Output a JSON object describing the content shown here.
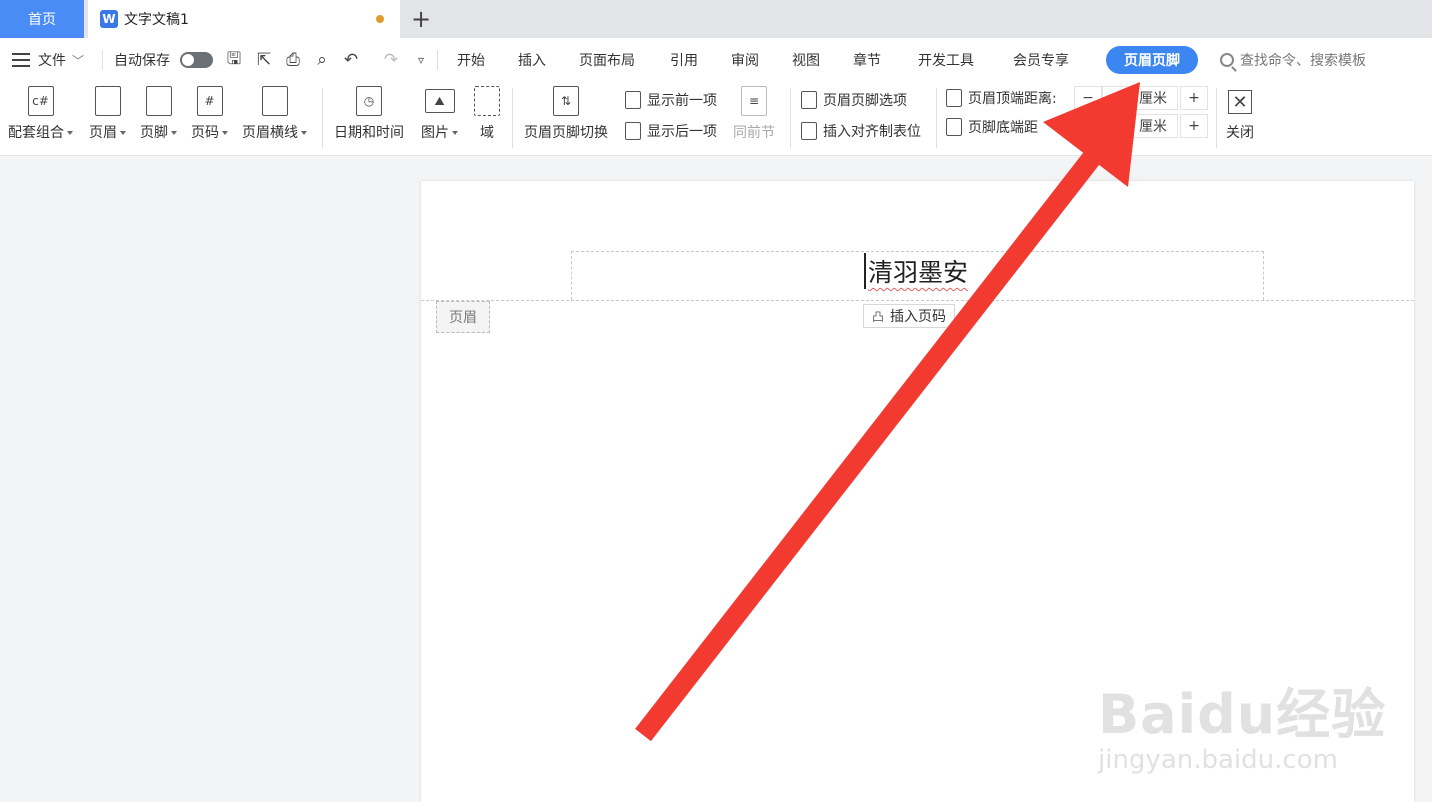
{
  "tabs": {
    "home_label": "首页",
    "doc_label": "文字文稿1",
    "doc_icon": "W",
    "unsaved_color": "#e09b2d"
  },
  "menubar": {
    "file_label": "文件",
    "autosave_label": "自动保存",
    "items": [
      "开始",
      "插入",
      "页面布局",
      "引用",
      "审阅",
      "视图",
      "章节",
      "开发工具",
      "会员专享"
    ],
    "active_label": "页眉页脚",
    "search_placeholder": "查找命令、搜索模板"
  },
  "ribbon": {
    "combo": "配套组合",
    "header": "页眉",
    "footer": "页脚",
    "page_number": "页码",
    "header_line": "页眉横线",
    "datetime": "日期和时间",
    "picture": "图片",
    "field": "域",
    "switch": "页眉页脚切换",
    "show_prev": "显示前一项",
    "show_next": "显示后一项",
    "same_as_prev": "同前节",
    "hf_options": "页眉页脚选项",
    "insert_align_tab": "插入对齐制表位",
    "header_top_dist": "页眉顶端距离:",
    "footer_bottom_dist": "页脚底端距",
    "unit": "厘米",
    "minus": "−",
    "plus": "+",
    "close": "关闭"
  },
  "document": {
    "header_text": "清羽墨安",
    "header_tag": "页眉",
    "insert_page_number": "插入页码"
  },
  "watermark": {
    "brand": "Baidu经验",
    "url": "jingyan.baidu.com"
  },
  "colors": {
    "accent": "#3b86f0",
    "home_tab": "#4a8cf5",
    "arrow": "#f23a30"
  }
}
